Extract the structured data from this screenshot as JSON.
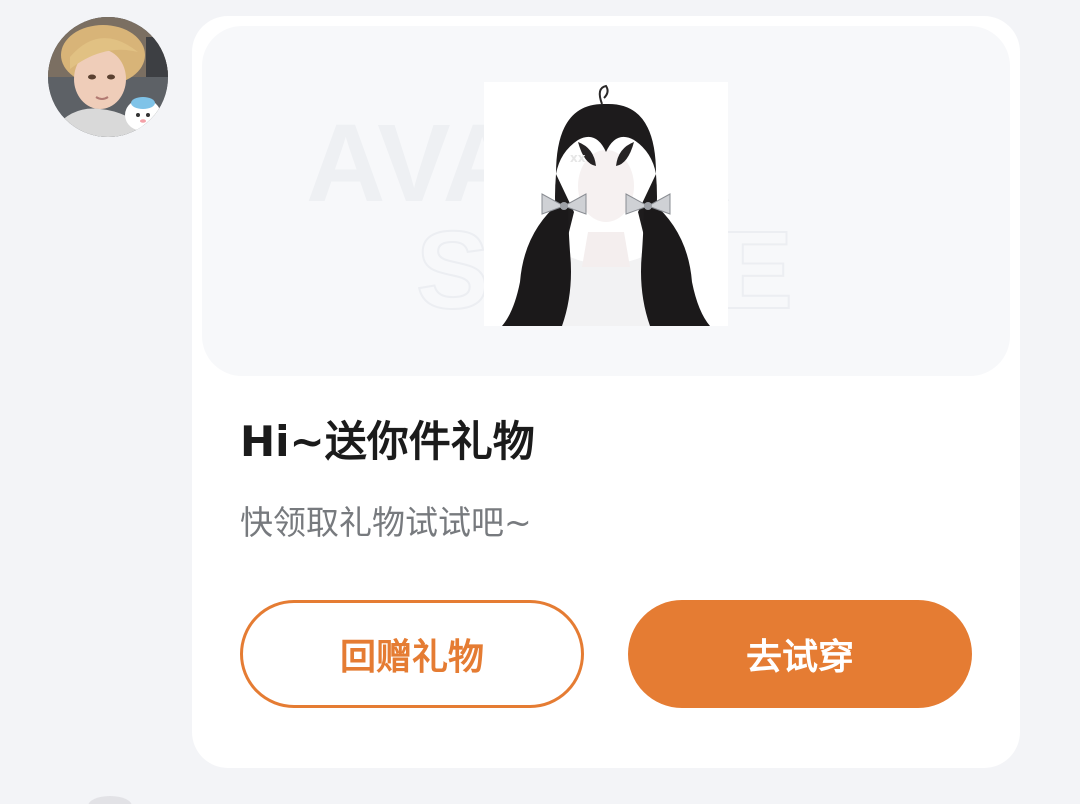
{
  "sender": {
    "avatar_icon": "user-avatar-photo"
  },
  "gift_card": {
    "banner": {
      "watermark_line1": "AVATAR",
      "watermark_line2": "STORE",
      "product_icon": "twin-tail-hair-item"
    },
    "title": "Hi~送你件礼物",
    "subtitle": "快领取礼物试试吧~",
    "buttons": {
      "return_gift_label": "回赠礼物",
      "try_on_label": "去试穿"
    },
    "accent_color": "#e57c33"
  }
}
